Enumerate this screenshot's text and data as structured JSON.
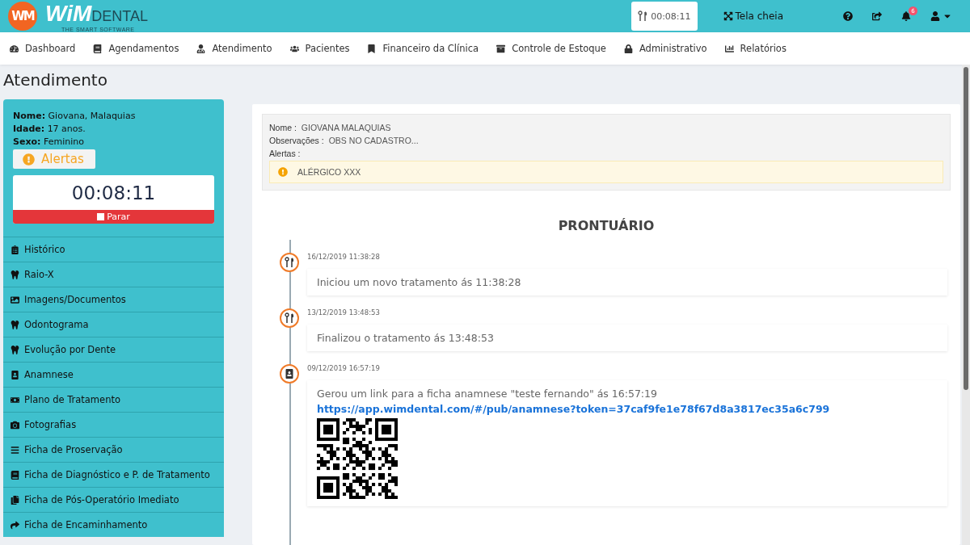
{
  "logo": {
    "mark": "WM",
    "brand": "WiM",
    "product": "DENTAL",
    "tagline": "THE SMART SOFTWARE"
  },
  "header": {
    "timer": "00:08:11",
    "fullscreen": "Tela cheia",
    "notifications": "6"
  },
  "nav": [
    {
      "label": "Dashboard"
    },
    {
      "label": "Agendamentos"
    },
    {
      "label": "Atendimento"
    },
    {
      "label": "Pacientes"
    },
    {
      "label": "Financeiro da Clínica"
    },
    {
      "label": "Controle de Estoque"
    },
    {
      "label": "Administrativo"
    },
    {
      "label": "Relatórios"
    }
  ],
  "page_title": "Atendimento",
  "patient": [
    {
      "label": "Nome:",
      "value": "Giovana, Malaquias"
    },
    {
      "label": "Idade:",
      "value": "17 anos."
    },
    {
      "label": "Sexo:",
      "value": "Feminino"
    }
  ],
  "alerts_button": "Alertas",
  "stopwatch": {
    "time": "00:08:11",
    "stop": "Parar"
  },
  "sidebar": [
    {
      "label": "Histórico"
    },
    {
      "label": "Raio-X"
    },
    {
      "label": "Imagens/Documentos"
    },
    {
      "label": "Odontograma"
    },
    {
      "label": "Evolução por Dente"
    },
    {
      "label": "Anamnese"
    },
    {
      "label": "Plano de Tratamento"
    },
    {
      "label": "Fotografias"
    },
    {
      "label": "Ficha de Proservação"
    },
    {
      "label": "Ficha de Diagnóstico e P. de Tratamento"
    },
    {
      "label": "Ficha de Pós-Operatório Imediato"
    },
    {
      "label": "Ficha de Encaminhamento"
    }
  ],
  "summary": {
    "fields": [
      {
        "label": "Nome :",
        "value": "GIOVANA MALAQUIAS"
      },
      {
        "label": "Observações :",
        "value": "OBS NO CADASTRO..."
      },
      {
        "label": "Alertas :"
      }
    ],
    "alerts": [
      "ALÉRGICO XXX"
    ]
  },
  "record_title": "PRONTUÁRIO",
  "timeline": [
    {
      "kind": "treatment",
      "date": "16/12/2019 11:38:28",
      "text": "Iniciou um novo tratamento ás 11:38:28"
    },
    {
      "kind": "treatment",
      "date": "13/12/2019 13:48:53",
      "text": "Finalizou o tratamento ás 13:48:53"
    },
    {
      "kind": "anamnese",
      "date": "09/12/2019 16:57:19",
      "text": "Gerou um link para a ficha anamnese \"teste fernando\" ás 16:57:19",
      "link": "https://app.wimdental.com/#/pub/anamnese?token=37caf9fe1e78f67d8a3817ec35a6c799",
      "qr": true
    }
  ]
}
